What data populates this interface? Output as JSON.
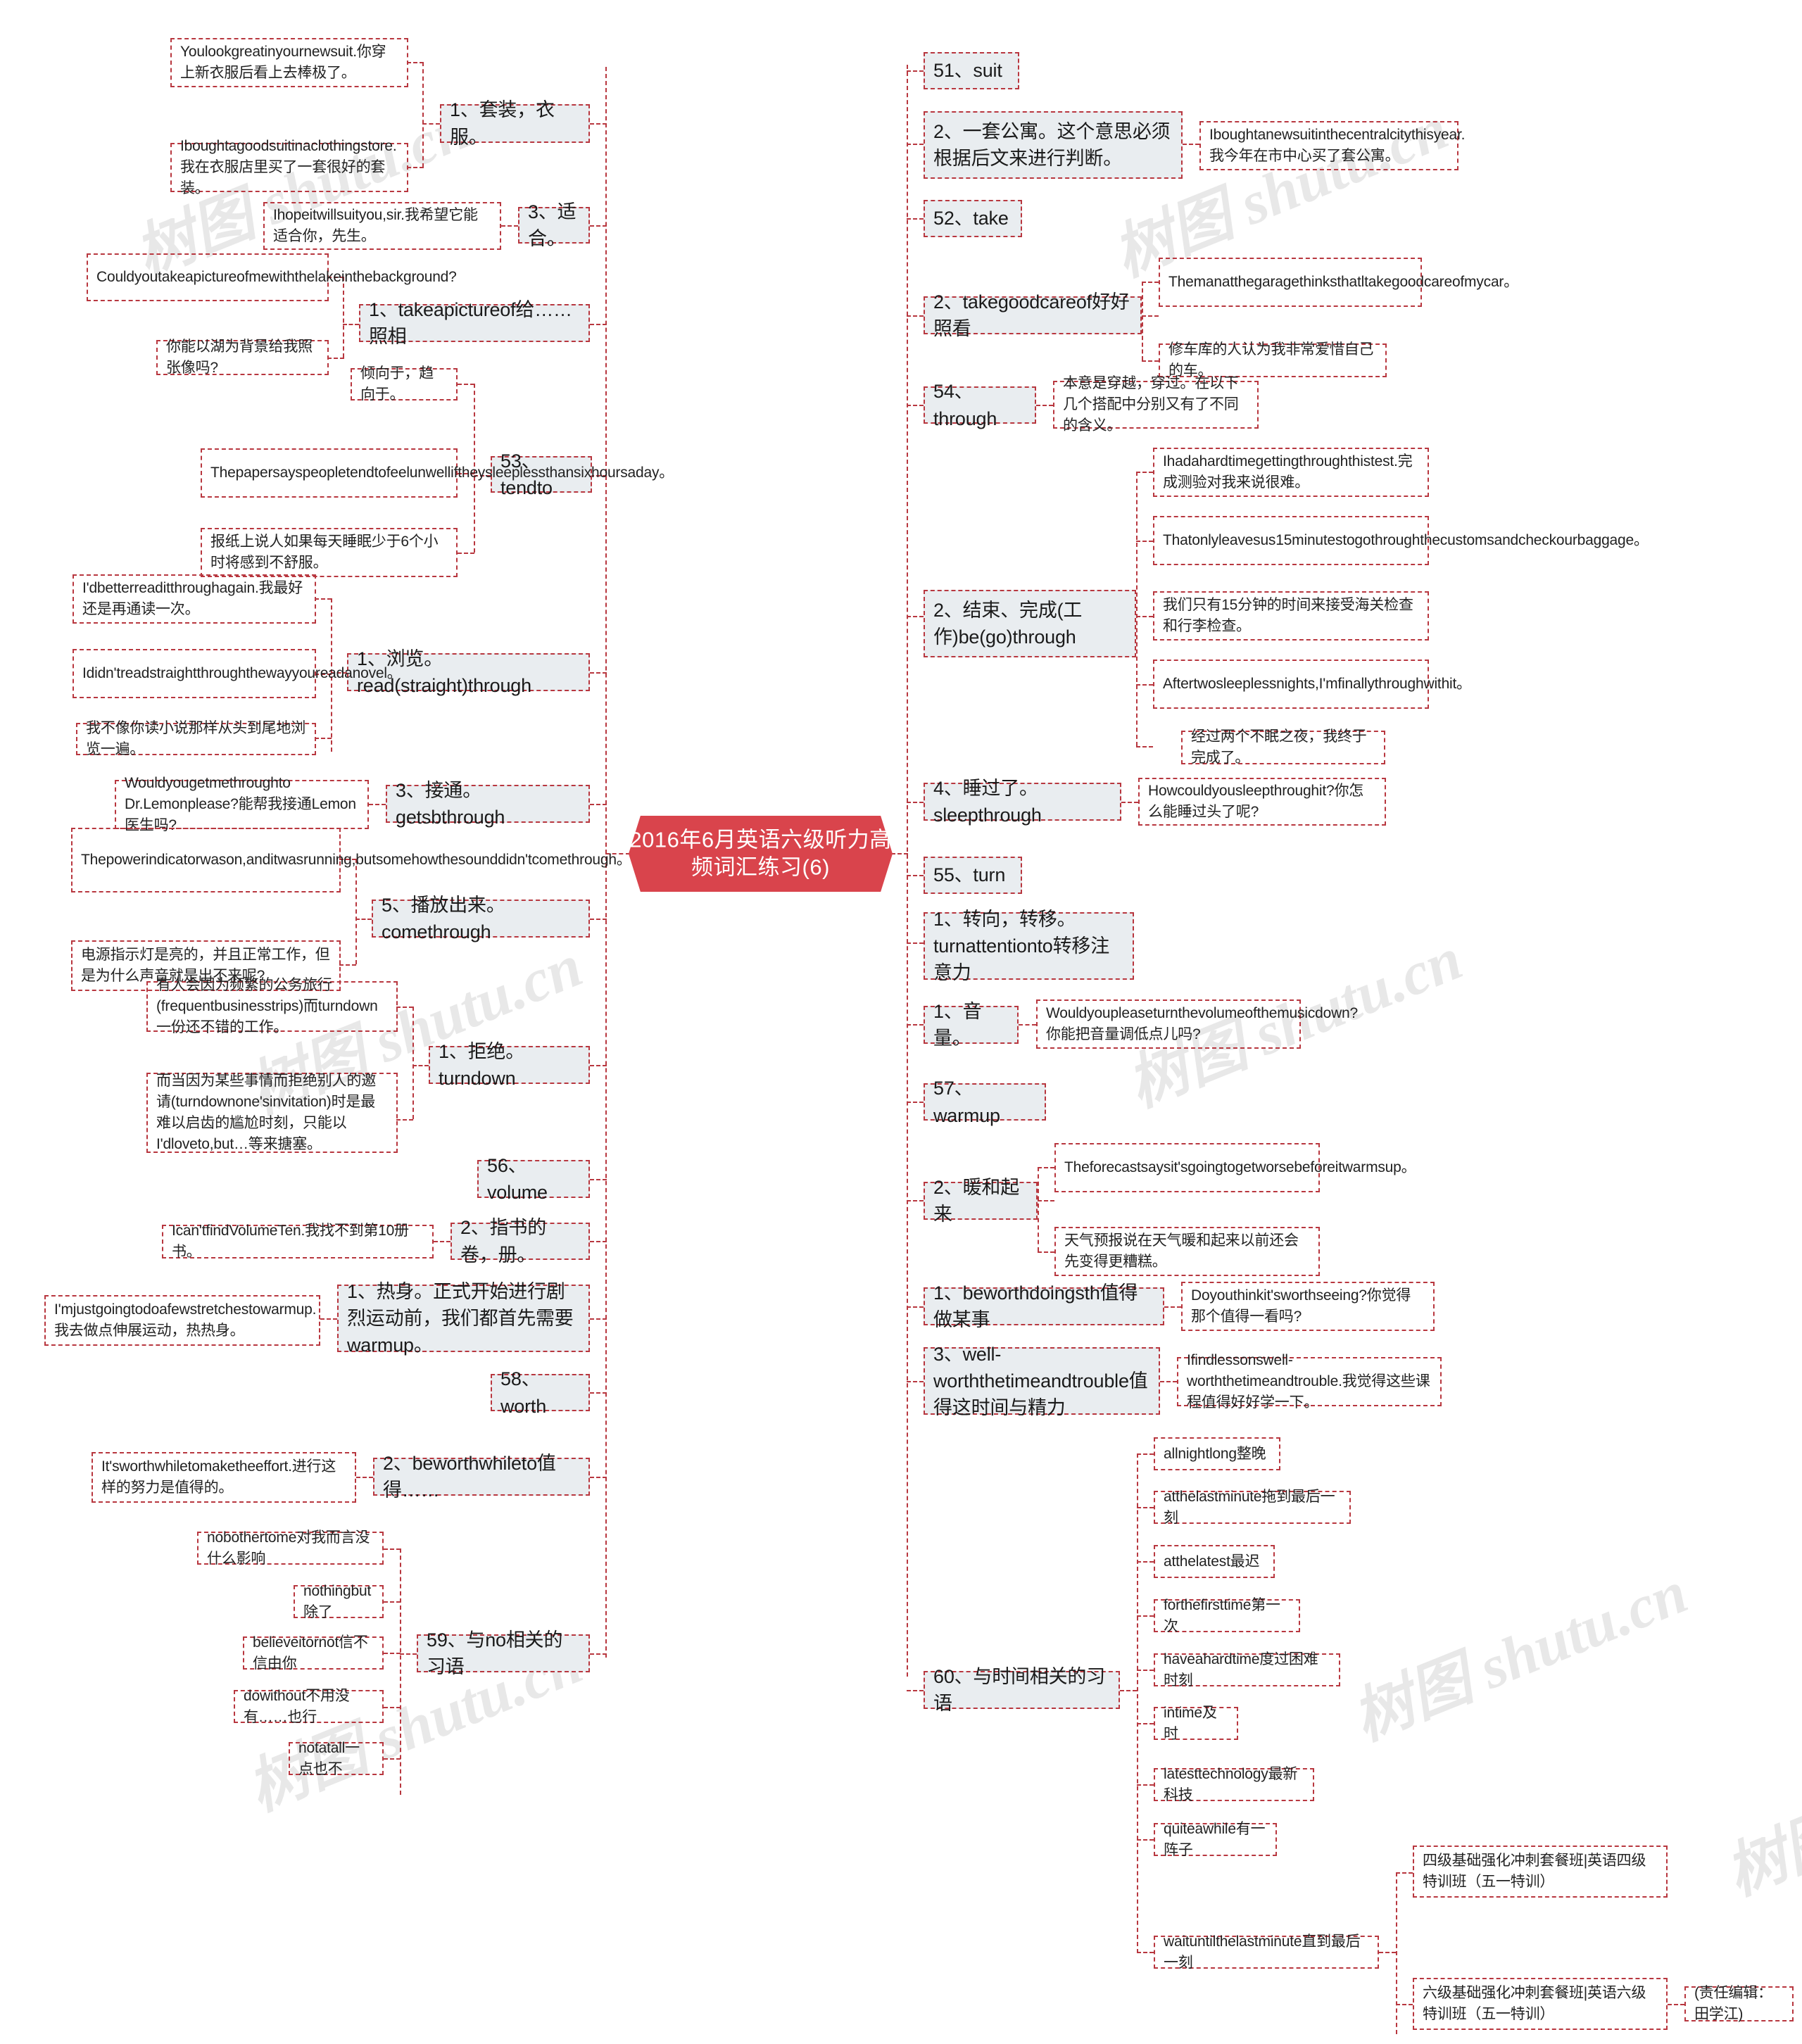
{
  "root": {
    "title": "2016年6月英语六级听力高频词汇练习(6)",
    "color": "#d9444c"
  },
  "watermark": {
    "text": "树图 shutu.cn"
  },
  "left_branches": [
    {
      "id": "suit-1",
      "label": "1、套装，衣服。",
      "children": [
        "Youlookgreatinyournewsuit.你穿上新衣服后看上去棒极了。",
        "Iboughtagoodsuitinaclothingstore.我在衣服店里买了一套很好的套装。"
      ]
    },
    {
      "id": "suit-3",
      "label": "3、适合。",
      "children": [
        "Ihopeitwillsuityou,sir.我希望它能适合你，先生。"
      ]
    },
    {
      "id": "take-1",
      "label": "1、takeapictureof给……照相",
      "children": [
        "Couldyoutakeapictureofmewiththelakeinthebackground?",
        "你能以湖为背景给我照张像吗?"
      ]
    },
    {
      "id": "tendto",
      "label": "53、tendto",
      "children": [
        "倾向于，趋向于。",
        "Thepapersayspeopletendtofeelunwelliftheysleeplessthansixhoursaday。",
        "报纸上说人如果每天睡眠少于6个小时将感到不舒服。"
      ]
    },
    {
      "id": "through-1",
      "label": "1、浏览。read(straight)through",
      "children": [
        "I'dbetterreaditthroughagain.我最好还是再通读一次。",
        "Ididn'treadstraightthroughthewayyoureadanovel。",
        "我不像你读小说那样从头到尾地浏览一遍。"
      ]
    },
    {
      "id": "through-3",
      "label": "3、接通。getsbthrough",
      "children": [
        "Wouldyougetmethroughto Dr.Lemonplease?能帮我接通Lemon医生吗?"
      ]
    },
    {
      "id": "through-5",
      "label": "5、播放出来。comethrough",
      "children": [
        "Thepowerindicatorwason,anditwasrunning,butsomehowthesounddidn'tcomethrough。",
        "电源指示灯是亮的，并且正常工作，但是为什么声音就是出不来呢?"
      ]
    },
    {
      "id": "turndown",
      "label": "1、拒绝。turndown",
      "children": [
        "有人会因为频繁的公务旅行(frequentbusinesstrips)而turndown一份还不错的工作。",
        "而当因为某些事情而拒绝别人的邀请(turndownone'sinvitation)时是最难以启齿的尴尬时刻，只能以I'dloveto,but…等来搪塞。"
      ]
    },
    {
      "id": "volume",
      "label": "56、volume",
      "children": []
    },
    {
      "id": "volume-2",
      "label": "2、指书的卷，册。",
      "children": [
        "Ican'tfindVolumeTen.我找不到第10册书。"
      ]
    },
    {
      "id": "warmup-1",
      "label": "1、热身。正式开始进行剧烈运动前，我们都首先需要warmup。",
      "children": [
        "I'mjustgoingtodoafewstretchestowarmup.我去做点伸展运动，热热身。"
      ]
    },
    {
      "id": "worth",
      "label": "58、worth",
      "children": []
    },
    {
      "id": "worth-2",
      "label": "2、beworthwhileto值得……",
      "children": [
        "It'sworthwhiletomaketheeffort.进行这样的努力是值得的。"
      ]
    },
    {
      "id": "no-idioms",
      "label": "59、与no相关的习语",
      "children": [
        "nobothertome对我而言没什么影响",
        "nothingbut除了",
        "believeitornot信不信由你",
        "dowithout不用没有……也行",
        "notatall一点也不"
      ]
    }
  ],
  "right_branches": [
    {
      "id": "suit",
      "label": "51、suit",
      "children": []
    },
    {
      "id": "suit-2",
      "label": "2、一套公寓。这个意思必须根据后文来进行判断。",
      "children": [
        "Iboughtanewsuitinthecentralcitythisyear.我今年在市中心买了套公寓。"
      ]
    },
    {
      "id": "take",
      "label": "52、take",
      "children": []
    },
    {
      "id": "take-2",
      "label": "2、takegoodcareof好好照看",
      "children": [
        "Themanatthegaragethinksthatltakegoodcareofmycar。",
        "修车库的人认为我非常爱惜自己的车。"
      ]
    },
    {
      "id": "through",
      "label": "54、through",
      "children": [
        "本意是穿越，穿过。在以下几个搭配中分别又有了不同的含义。"
      ]
    },
    {
      "id": "through-2",
      "label": "2、结束、完成(工作)be(go)through",
      "children": [
        "Ihadahardtimegettingthroughthistest.完成测验对我来说很难。",
        "Thatonlyleavesus15minutestogothroughthecustomsandcheckourbaggage。",
        "我们只有15分钟的时间来接受海关检查和行李检查。",
        "Aftertwosleeplessnights,I'mfinallythroughwithit。",
        "经过两个不眠之夜，我终于完成了。"
      ]
    },
    {
      "id": "sleepthrough",
      "label": "4、睡过了。sleepthrough",
      "children": [
        "Howcouldyousleepthroughit?你怎么能睡过头了呢?"
      ]
    },
    {
      "id": "turn",
      "label": "55、turn",
      "children": []
    },
    {
      "id": "turn-1",
      "label": "1、转向，转移。turnattentionto转移注意力",
      "children": []
    },
    {
      "id": "turn-volume",
      "label": "1、音量。",
      "children": [
        "Wouldyoupleaseturnthevolumeofthemusicdown?你能把音量调低点儿吗?"
      ]
    },
    {
      "id": "warmup",
      "label": "57、warmup",
      "children": []
    },
    {
      "id": "warmup-2",
      "label": "2、暖和起来",
      "children": [
        "Theforecastsaysit'sgoingtogetworsebeforeitwarmsup。",
        "天气预报说在天气暖和起来以前还会先变得更糟糕。"
      ]
    },
    {
      "id": "worth-doing",
      "label": "1、beworthdoingsth值得做某事",
      "children": [
        "Doyouthinkit'sworthseeing?你觉得那个值得一看吗?"
      ]
    },
    {
      "id": "well-worth",
      "label": "3、well-worththetimeandtrouble值得这时间与精力",
      "children": [
        "Ifindlessonswell-worththetimeandtrouble.我觉得这些课程值得好好学一下。"
      ]
    },
    {
      "id": "time-idioms",
      "label": "60、与时间相关的习语",
      "children": [
        "allnightlong整晚",
        "atthelastminute拖到最后一刻",
        "atthelatest最迟",
        "forthefirsttime第一次",
        "haveahardtime度过困难时刻",
        "intime及时",
        "latesttechnology最新科技",
        "quiteawhile有一阵子",
        "waituntilthelastminute直到最后一刻"
      ]
    }
  ],
  "footer": {
    "course_cet4": "四级基础强化冲刺套餐班|英语四级特训班（五一特训）",
    "course_cet6": "六级基础强化冲刺套餐班|英语六级特训班（五一特训）",
    "editor": "(责任编辑：田学江)"
  }
}
